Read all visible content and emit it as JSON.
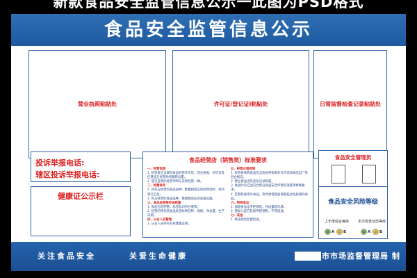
{
  "caption": "新款食品安全监管信息公示一此图为PSD格式",
  "banner": {
    "title": "食品安全监管信息公示"
  },
  "panels": {
    "license": "营业执照粘贴处",
    "permit": "许可证/登记证I粘贴处",
    "inspection": "日常监督检查记录粘贴处"
  },
  "report": {
    "phone_label": "投诉举报电话:",
    "district_label": "辖区投诉举报电话:"
  },
  "health": {
    "title": "健康证公示栏"
  },
  "requirements": {
    "title": "食品经营店（销售类）标准要求",
    "col1": [
      {
        "t": "一、经营资质",
        "h": true
      },
      {
        "t": "1. 经营者应当取得食品经营许可证，营业执照、许可证等应悬挂在经营场所醒目位置。",
        "h": false
      },
      {
        "t": "2. 登记证明的经营项目与实际经营一致。",
        "h": false
      },
      {
        "t": "二、经营条件",
        "h": true
      },
      {
        "t": "1. 具有与经营的食品品种、数量相适应的经营场所，保持清洁卫生。",
        "h": false
      },
      {
        "t": "2. 有与经营的食品品种、数量相适应的设备设施。",
        "h": false
      },
      {
        "t": "三、食品标签等外观质量",
        "h": true
      },
      {
        "t": "1. 食品包装完整，标签标识符合要求。",
        "h": false
      },
      {
        "t": "2. 经营的预包装食品标签标明名称、规格、净含量、生产日期。",
        "h": false
      },
      {
        "t": "四、从业人员管理",
        "h": true
      },
      {
        "t": "1. 从业人员持有有效健康证明。",
        "h": false
      }
    ],
    "col2": [
      {
        "t": "五、经营过程控制",
        "h": true
      },
      {
        "t": "1. 经营者采购食品应当查验供货者的许可证和食品出厂检验合格证。",
        "h": false
      },
      {
        "t": "2. 建立食品进货查验记录制度。",
        "h": false
      },
      {
        "t": "3. 食品贮存应当符合保证食品安全所需的温度等特殊要求。",
        "h": false
      },
      {
        "t": "4. 定期检查库存食品，及时清理变质或者超过保质期的食品。",
        "h": false
      },
      {
        "t": "六、特殊食品",
        "h": true
      },
      {
        "t": "1. 保健食品设专柜销售，并设置提示牌。",
        "h": false
      },
      {
        "t": "2. 婴幼儿配方乳粉专柜销售，不得混放。",
        "h": false
      },
      {
        "t": "七、其他",
        "h": true
      },
      {
        "t": "1. 依法配合监督检查。",
        "h": false
      }
    ]
  },
  "manager": {
    "title": "食品安全管理员"
  },
  "risk": {
    "title": "食品安全风险等级",
    "left_label": "上年度综合等级",
    "right_label": "本次检查动态等级",
    "grades": [
      "A",
      "B",
      "C"
    ]
  },
  "footer": {
    "slogan_left": "关注食品安全",
    "slogan_right": "关爱生命健康",
    "signature": "市市场监督管理局 制"
  },
  "colors": {
    "blue": "#2d63a8",
    "red": "#dd2222",
    "black": "#000000"
  }
}
